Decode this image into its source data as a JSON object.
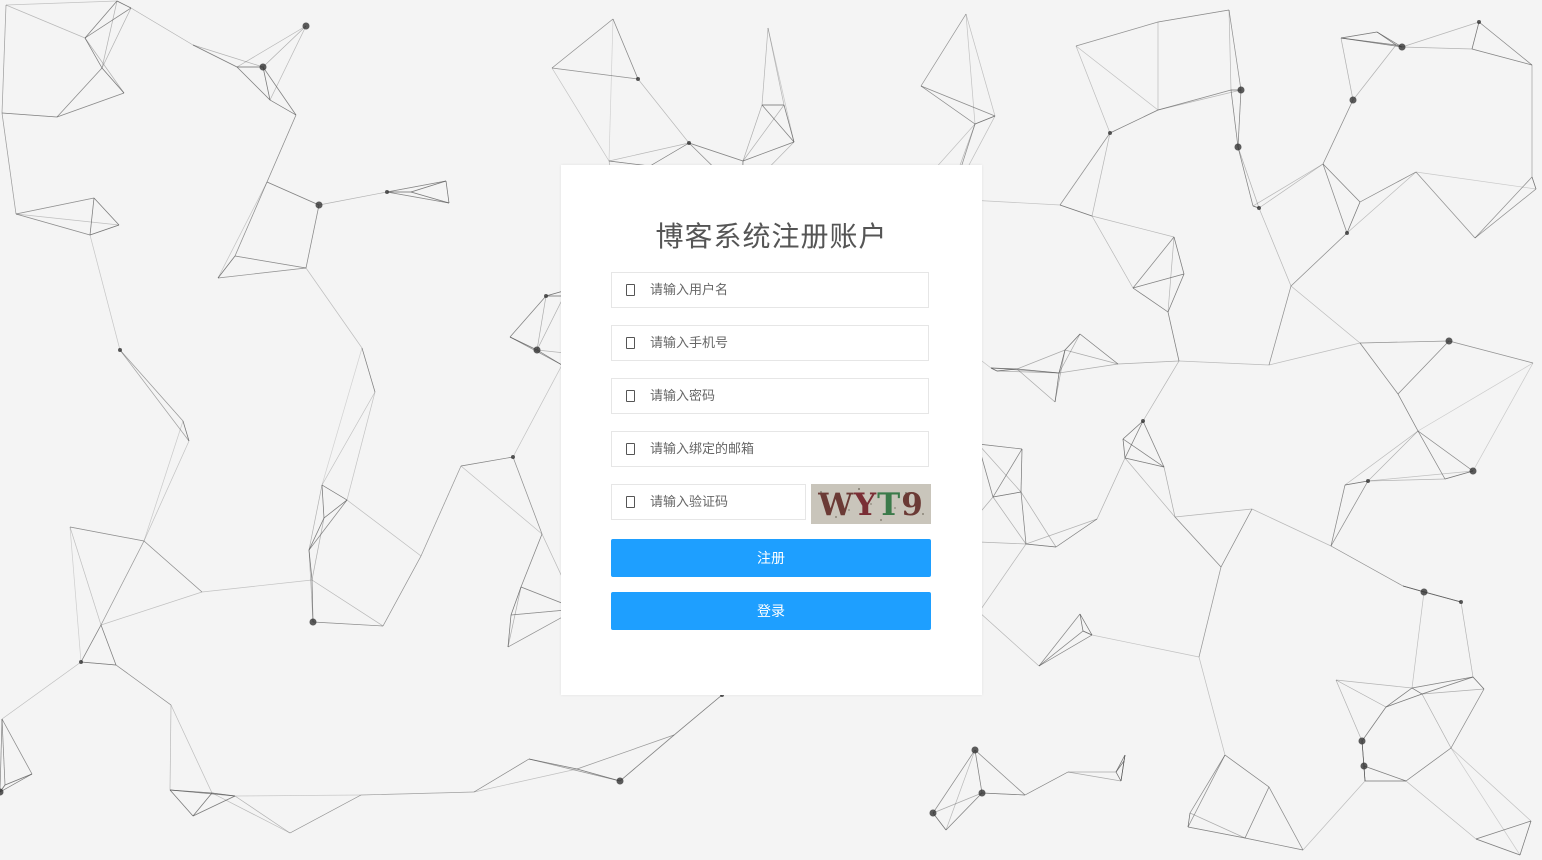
{
  "form": {
    "title": "博客系统注册账户",
    "username_placeholder": "请输入用户名",
    "phone_placeholder": "请输入手机号",
    "password_placeholder": "请输入密码",
    "email_placeholder": "请输入绑定的邮箱",
    "captcha_placeholder": "请输入验证码",
    "captcha_code": "WYT9",
    "register_label": "注册",
    "login_label": "登录"
  },
  "icons": {
    "username": "user-icon",
    "phone": "phone-icon",
    "password": "lock-icon",
    "email": "email-icon",
    "captcha": "captcha-icon"
  },
  "colors": {
    "accent": "#1e9fff",
    "background": "#f4f4f4",
    "card": "#ffffff"
  }
}
